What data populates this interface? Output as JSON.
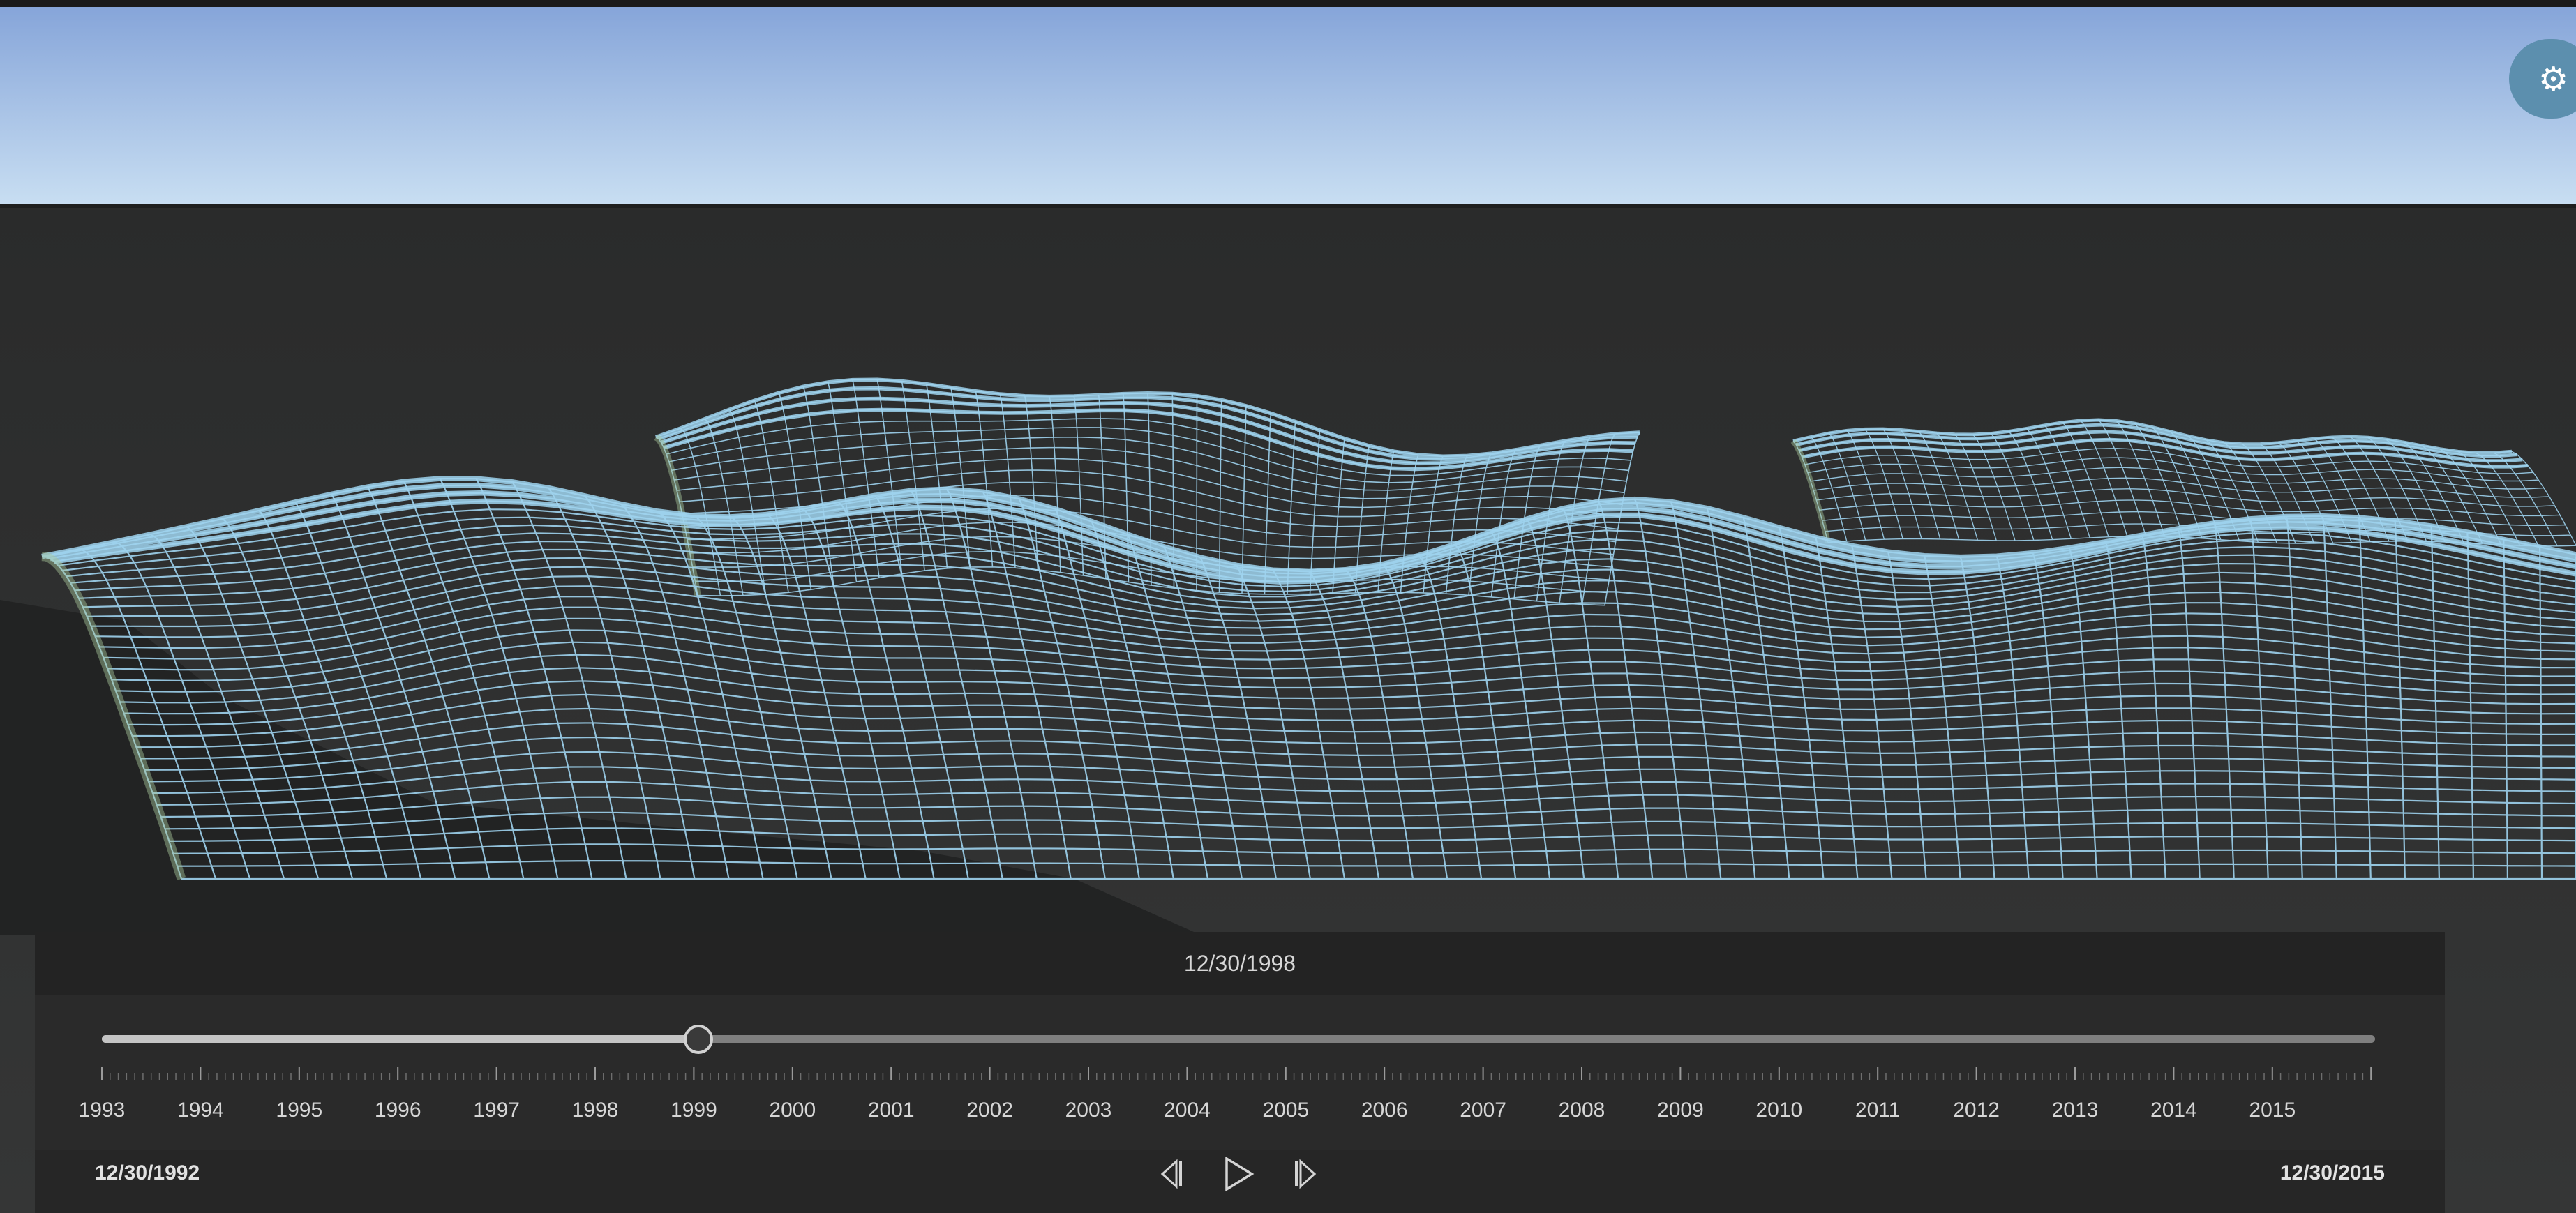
{
  "settings": {
    "icon": "gear-icon",
    "color": "#5c8fae"
  },
  "time_slider": {
    "current_date": "12/30/1998",
    "start_date": "12/30/1992",
    "end_date": "12/30/2015",
    "progress": 0.262,
    "years": [
      "1993",
      "1994",
      "1995",
      "1996",
      "1997",
      "1998",
      "1999",
      "2000",
      "2001",
      "2002",
      "2003",
      "2004",
      "2005",
      "2006",
      "2007",
      "2008",
      "2009",
      "2010",
      "2011",
      "2012",
      "2013",
      "2014",
      "2015"
    ],
    "controls": {
      "previous_icon": "step-back-icon",
      "play_icon": "play-icon",
      "next_icon": "step-forward-icon"
    }
  },
  "scene": {
    "sky_top": "#86a5d9",
    "sky_bottom": "#c6dcf0",
    "ground": "#2e2f2f",
    "mesh_color": "#9fd3ee",
    "mesh_edge_color": "#a9c79b"
  }
}
